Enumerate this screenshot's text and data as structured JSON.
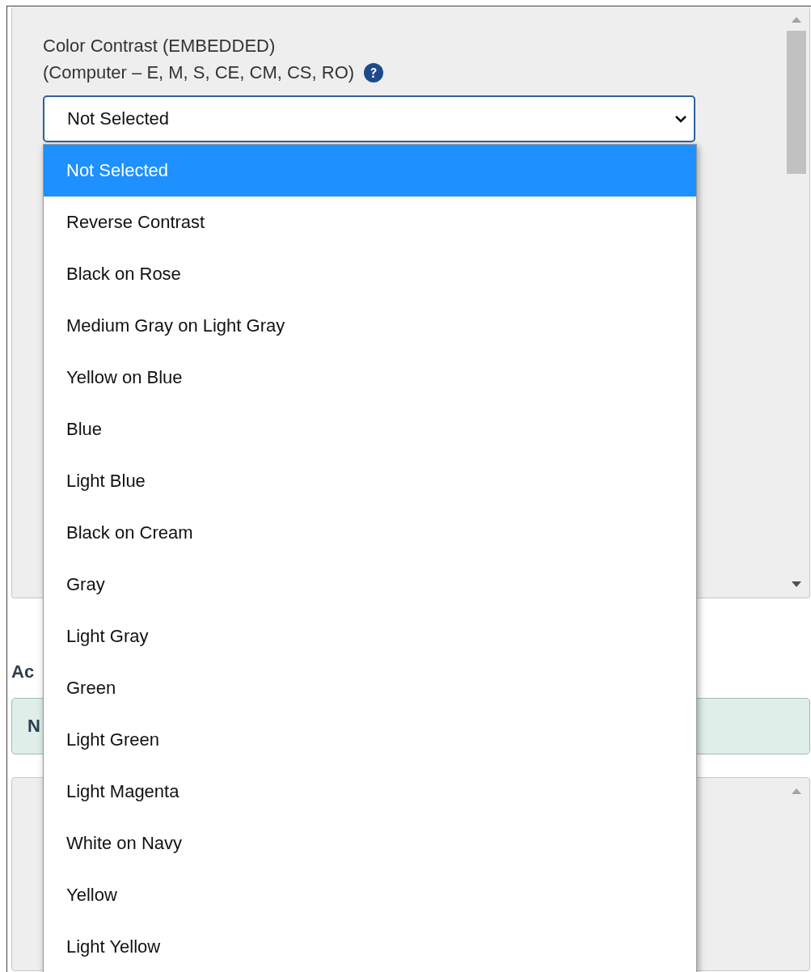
{
  "field": {
    "label_lines": [
      "Color Contrast (EMBEDDED)",
      "(Computer – E, M, S, CE, CM, CS, RO)"
    ],
    "value": "Not Selected",
    "expanded": true
  },
  "options": [
    {
      "label": "Not Selected",
      "selected": true
    },
    {
      "label": "Reverse Contrast",
      "selected": false
    },
    {
      "label": "Black on Rose",
      "selected": false
    },
    {
      "label": "Medium Gray on Light Gray",
      "selected": false
    },
    {
      "label": "Yellow on Blue",
      "selected": false
    },
    {
      "label": "Blue",
      "selected": false
    },
    {
      "label": "Light Blue",
      "selected": false
    },
    {
      "label": "Black on Cream",
      "selected": false
    },
    {
      "label": "Gray",
      "selected": false
    },
    {
      "label": "Light Gray",
      "selected": false
    },
    {
      "label": "Green",
      "selected": false
    },
    {
      "label": "Light Green",
      "selected": false
    },
    {
      "label": "Light Magenta",
      "selected": false
    },
    {
      "label": "White on Navy",
      "selected": false
    },
    {
      "label": "Yellow",
      "selected": false
    },
    {
      "label": "Light Yellow",
      "selected": false
    }
  ],
  "section_heading": "Ac",
  "notice": "N"
}
